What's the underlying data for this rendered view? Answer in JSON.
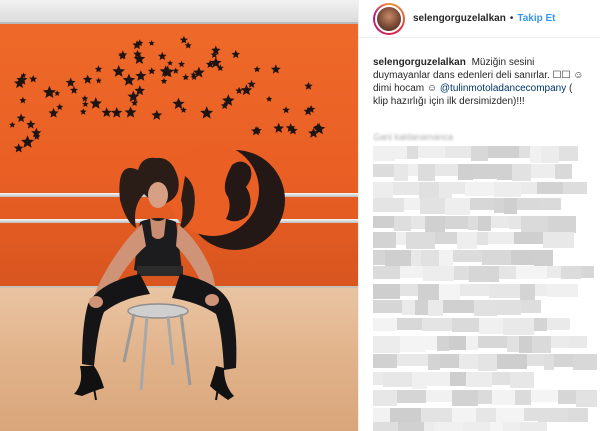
{
  "post": {
    "header": {
      "username": "selengorguzelalkan",
      "separator": "•",
      "follow_label": "Takip Et"
    },
    "caption": {
      "username": "selengorguzelalkan",
      "text_1": "Müziğin sesini duymayanlar dans edenleri deli sanırlar. ☐☐ ☺ dimi hocam ☺",
      "mention": "@tulinmotoladancecompany",
      "text_2": "( klip hazırlığı için ilk dersimizden)!!!"
    },
    "media": {
      "description_icon": "dancer-photo"
    },
    "comments_ghost_text": "Gani kaldanamanca"
  },
  "colors": {
    "follow_blue": "#3897f0",
    "wall_orange": "#e95f24",
    "text_dark": "#262626"
  }
}
